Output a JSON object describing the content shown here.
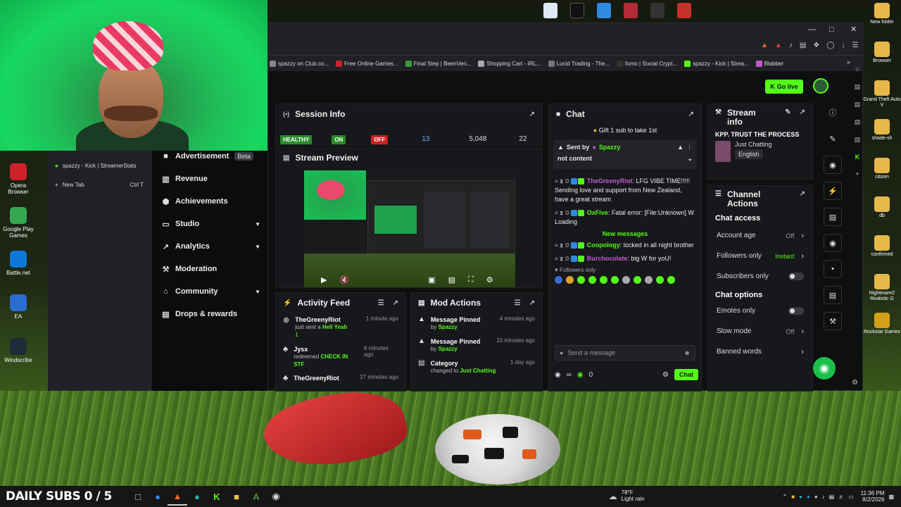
{
  "overlay_text": "DAILY SUBS 0 / 5",
  "desktop_icons_left": [
    {
      "label": "Opera Browser",
      "color": "#d0202a",
      "icon": "opera-icon"
    },
    {
      "label": "Google Play Games",
      "color": "#34a853",
      "icon": "play-games-icon"
    },
    {
      "label": "Battle.net",
      "color": "#0d78d8",
      "icon": "battlenet-icon"
    },
    {
      "label": "EA",
      "color": "#2b6cd0",
      "icon": "ea-icon"
    },
    {
      "label": "Windscribe",
      "color": "#1f2b36",
      "icon": "windscribe-icon"
    }
  ],
  "desktop_icons_right": [
    {
      "label": "New folder",
      "color": "#e6b84a"
    },
    {
      "label": "Browser",
      "color": "#e6b84a"
    },
    {
      "label": "Grand Theft Auto V",
      "color": "#e6b84a"
    },
    {
      "label": "shade-sh",
      "color": "#e6b84a"
    },
    {
      "label": "citizen",
      "color": "#e6b84a"
    },
    {
      "label": "db",
      "color": "#e6b84a"
    },
    {
      "label": "confirmed",
      "color": "#e6b84a"
    },
    {
      "label": "NightmareZ Realistic G",
      "color": "#e6b84a"
    },
    {
      "label": "Rockstar Games",
      "color": "#d4a017"
    }
  ],
  "bookmarks": [
    {
      "label": "spazzy on Club.co...",
      "color": "#888"
    },
    {
      "label": "Free Online Games...",
      "color": "#d0202a"
    },
    {
      "label": "Final Step | BeenVeri...",
      "color": "#3a9b3a"
    },
    {
      "label": "Shopping Cart - IRL...",
      "color": "#aaa"
    },
    {
      "label": "Lucid Trading - The...",
      "color": "#777"
    },
    {
      "label": "fomo | Social Crypt...",
      "color": "#333"
    },
    {
      "label": "spazzy - Kick | Strea...",
      "color": "#53fc18"
    },
    {
      "label": "Blabber",
      "color": "#c05bd0"
    }
  ],
  "overlay_panel": {
    "tab_label": "spazzy - Kick | StreamerStats",
    "new_tab": "New Tab",
    "shortcut": "Ctrl T"
  },
  "header": {
    "go_live": "Go live"
  },
  "menu": [
    {
      "label": "Advertisement",
      "badge": "Beta",
      "icon": "ad-icon",
      "chev": false
    },
    {
      "label": "Revenue",
      "badge": "",
      "icon": "revenue-icon",
      "chev": false
    },
    {
      "label": "Achievements",
      "badge": "",
      "icon": "trophy-icon",
      "chev": false
    },
    {
      "label": "Studio",
      "badge": "",
      "icon": "studio-icon",
      "chev": true
    },
    {
      "label": "Analytics",
      "badge": "",
      "icon": "analytics-icon",
      "chev": true
    },
    {
      "label": "Moderation",
      "badge": "",
      "icon": "wrench-icon",
      "chev": false
    },
    {
      "label": "Community",
      "badge": "",
      "icon": "community-icon",
      "chev": true
    },
    {
      "label": "Drops & rewards",
      "badge": "",
      "icon": "drops-icon",
      "chev": false
    }
  ],
  "session": {
    "title": "Session Info",
    "status": [
      "HEALTHY",
      "ON",
      "OFF"
    ],
    "stats": [
      "13",
      "5,048",
      "22"
    ]
  },
  "preview": {
    "title": "Stream Preview"
  },
  "activity": {
    "title": "Activity Feed",
    "items": [
      {
        "name": "TheGreenyRiot",
        "action": "just sent a",
        "highlight": "Hell Yeah",
        "extra": "1",
        "time": "1 minute ago"
      },
      {
        "name": "Jysx",
        "action": "redeemed",
        "highlight": "CHECK IN STF",
        "extra": "",
        "time": "6 minutes ago"
      },
      {
        "name": "TheGreenyRiot",
        "action": "",
        "highlight": "",
        "extra": "",
        "time": "27 minutes ago"
      }
    ]
  },
  "modactions": {
    "title": "Mod Actions",
    "items": [
      {
        "title": "Message Pinned",
        "by": "by",
        "who": "Spazzy",
        "time": "4 minutes ago"
      },
      {
        "title": "Message Pinned",
        "by": "by",
        "who": "Spazzy",
        "time": "10 minutes ago"
      },
      {
        "title": "Category",
        "by": "changed to",
        "who": "Just Chatting",
        "time": "1 day ago"
      }
    ]
  },
  "chat": {
    "title": "Chat",
    "gift": "Gift 1 sub to take 1st",
    "pinned_by": "Sent by",
    "pinned_user": "Spazzy",
    "pinned_text": "not content",
    "messages": [
      {
        "user": "TheGreenyRiot",
        "text": ": LFG VIBE TIME!!!!! Sending love and support from New Zealand, have a great stream",
        "color": "#c05bd0"
      },
      {
        "user": "OxFive",
        "text": ": Fatal error: [File:Unknown] W Loading",
        "color": "#53fc18"
      },
      {
        "user": "Coopology",
        "text": ": locked in all night brother",
        "color": "#53fc18"
      },
      {
        "user": "Burchocolate",
        "text": ": big W for yoU!",
        "color": "#c05bd0"
      }
    ],
    "new_messages": "New messages",
    "followers_only": "Followers only",
    "placeholder": "Send a message",
    "count": "0",
    "send": "Chat"
  },
  "stream_info": {
    "title": "Stream info",
    "stream_title": "KPP. TRUST THE PROCESS",
    "category": "Just Chatting",
    "language": "English"
  },
  "channel_actions": {
    "title": "Channel Actions",
    "access_title": "Chat access",
    "access": [
      {
        "label": "Account age",
        "value": "Off",
        "type": "chev"
      },
      {
        "label": "Followers only",
        "value": "Instant",
        "type": "chev"
      },
      {
        "label": "Subscribers only",
        "value": "",
        "type": "toggle"
      }
    ],
    "options_title": "Chat options",
    "options": [
      {
        "label": "Emotes only",
        "value": "",
        "type": "toggle"
      },
      {
        "label": "Slow mode",
        "value": "Off",
        "type": "chev"
      },
      {
        "label": "Banned words",
        "value": "",
        "type": "chev"
      }
    ]
  },
  "taskbar": {
    "temp": "78°F",
    "weather": "Light rain",
    "time": "11:36 PM",
    "date": "8/2/2026"
  }
}
